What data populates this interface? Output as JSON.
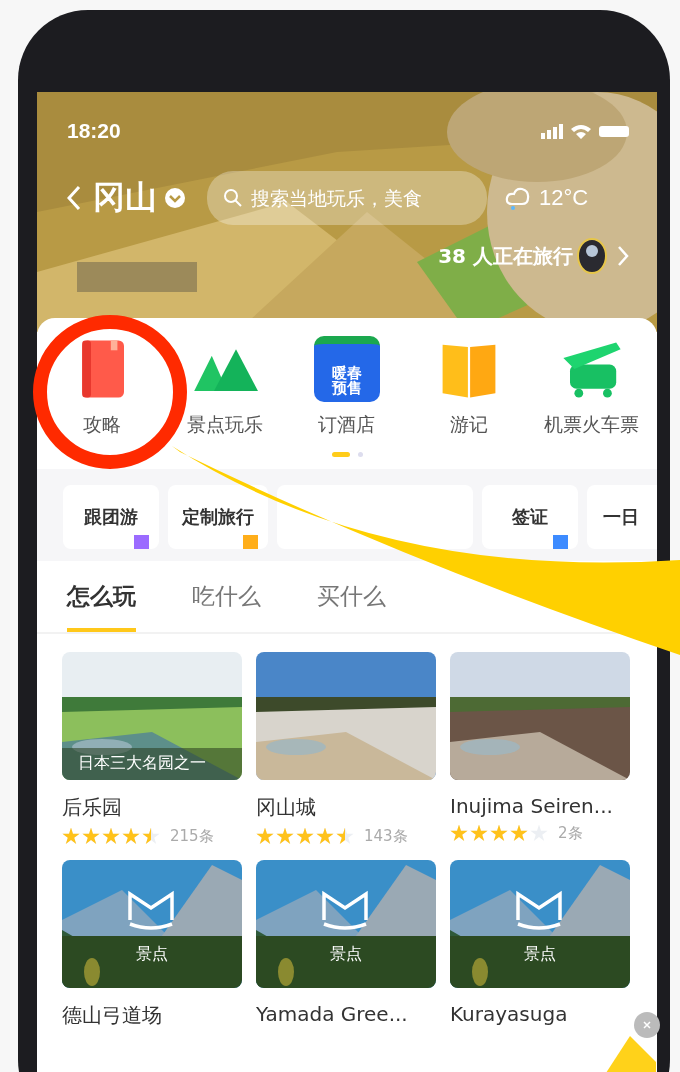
{
  "status_bar": {
    "time": "18:20"
  },
  "header": {
    "city": "冈山",
    "search": {
      "placeholder": "搜索当地玩乐，美食"
    },
    "weather": "12°C",
    "travelers": "38 人正在旅行"
  },
  "categories": [
    {
      "label": "攻略",
      "kind": "guide"
    },
    {
      "label": "景点玩乐",
      "kind": "mountain"
    },
    {
      "label": "订酒店",
      "kind": "hotel",
      "badge": "暖春预售"
    },
    {
      "label": "游记",
      "kind": "book"
    },
    {
      "label": "机票火车票",
      "kind": "plane"
    }
  ],
  "pager": [
    {
      "selected": true
    },
    {
      "selected": false
    }
  ],
  "chips": [
    {
      "label": "跟团游",
      "color": "#9b6bff"
    },
    {
      "label": "定制旅行",
      "color": "#ffae1a"
    },
    {
      "kind": "covered"
    },
    {
      "label": "签证",
      "color": "#3d8bff"
    },
    {
      "label": "一日"
    }
  ],
  "tabs": [
    {
      "label": "怎么玩",
      "selected": true
    },
    {
      "label": "吃什么",
      "selected": false
    },
    {
      "label": "买什么",
      "selected": false
    }
  ],
  "places": [
    {
      "name": "后乐园",
      "caption": "日本三大名园之一",
      "stars": 4.5,
      "reviews": "215条",
      "kind": "picture"
    },
    {
      "name": "冈山城",
      "stars": 4.5,
      "reviews": "143条",
      "kind": "picture"
    },
    {
      "name": "Inujima Seiren...",
      "stars": 4,
      "reviews": "2条",
      "kind": "picture"
    },
    {
      "name": "德山弓道场",
      "caption": "景点",
      "kind": "placeholder"
    },
    {
      "name": "Yamada Gree...",
      "caption": "景点",
      "kind": "placeholder"
    },
    {
      "name": "Kurayasuga",
      "caption": "景点",
      "kind": "placeholder"
    }
  ],
  "annotation": {
    "shows_circle": true,
    "shows_arrow": true
  }
}
